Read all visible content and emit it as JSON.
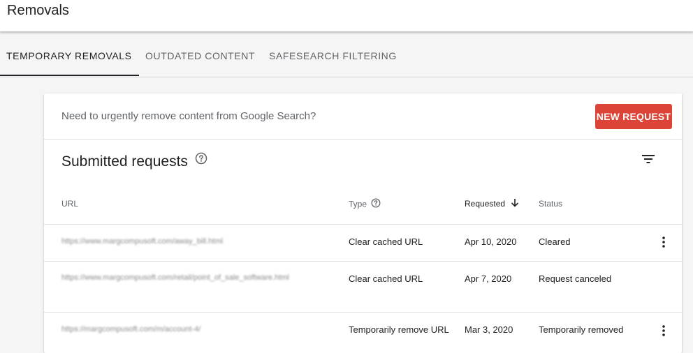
{
  "header": {
    "title": "Removals"
  },
  "tabs": [
    {
      "label": "TEMPORARY REMOVALS",
      "active": true
    },
    {
      "label": "OUTDATED CONTENT",
      "active": false
    },
    {
      "label": "SAFESEARCH FILTERING",
      "active": false
    }
  ],
  "card": {
    "banner_text": "Need to urgently remove content from Google Search?",
    "new_request_label": "NEW REQUEST",
    "section_title": "Submitted requests",
    "columns": {
      "url": "URL",
      "type": "Type",
      "requested": "Requested",
      "status": "Status"
    },
    "rows": [
      {
        "url": "https://www.margcompusoft.com/away_bill.html",
        "type": "Clear cached URL",
        "requested": "Apr 10, 2020",
        "status": "Cleared"
      },
      {
        "url": "https://www.margcompusoft.com/retail/point_of_sale_software.html",
        "type": "Clear cached URL",
        "requested": "Apr 7, 2020",
        "status": "Request canceled"
      },
      {
        "url": "https://margcompusoft.com/m/account-4/",
        "type": "Temporarily remove URL",
        "requested": "Mar 3, 2020",
        "status": "Temporarily removed"
      }
    ]
  },
  "colors": {
    "accent_button": "#db4437",
    "active_tab": "#202124",
    "muted_text": "#5f6368"
  },
  "icons": {
    "help": "help-circle-icon",
    "filter": "filter-list-icon",
    "sort": "arrow-down-icon",
    "more": "more-vert-icon"
  }
}
